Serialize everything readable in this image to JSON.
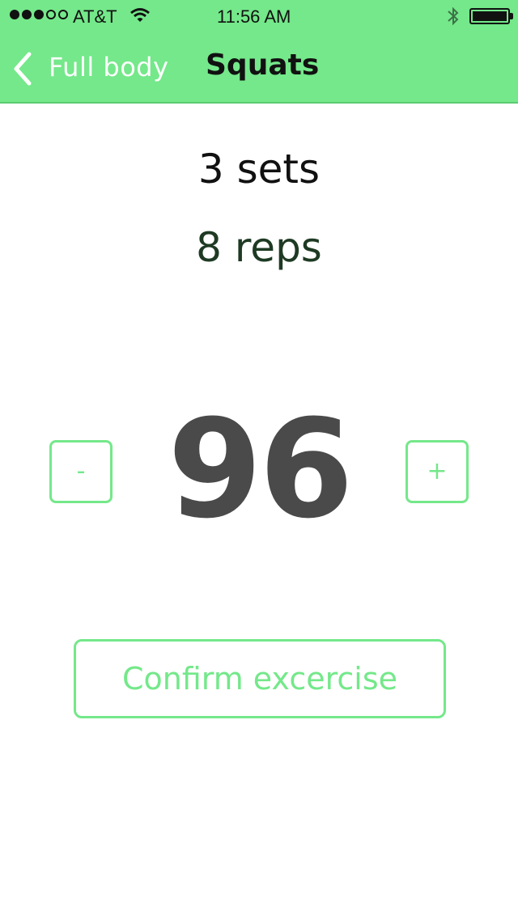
{
  "status_bar": {
    "signal_bars_filled": 3,
    "signal_bars_total": 5,
    "carrier": "AT&T",
    "time": "11:56 AM",
    "wifi_icon": "wifi-icon",
    "bluetooth_icon": "bluetooth-icon",
    "battery_level": 1.0
  },
  "nav": {
    "back_label": "Full body",
    "title": "Squats"
  },
  "exercise": {
    "sets_text": "3 sets",
    "reps_text": "8 reps",
    "weight_value": "96",
    "decrement_label": "-",
    "increment_label": "+",
    "confirm_label": "Confirm excercise"
  },
  "colors": {
    "accent": "#74e88a",
    "value": "#4a4a4a",
    "reps": "#1e3a23"
  }
}
